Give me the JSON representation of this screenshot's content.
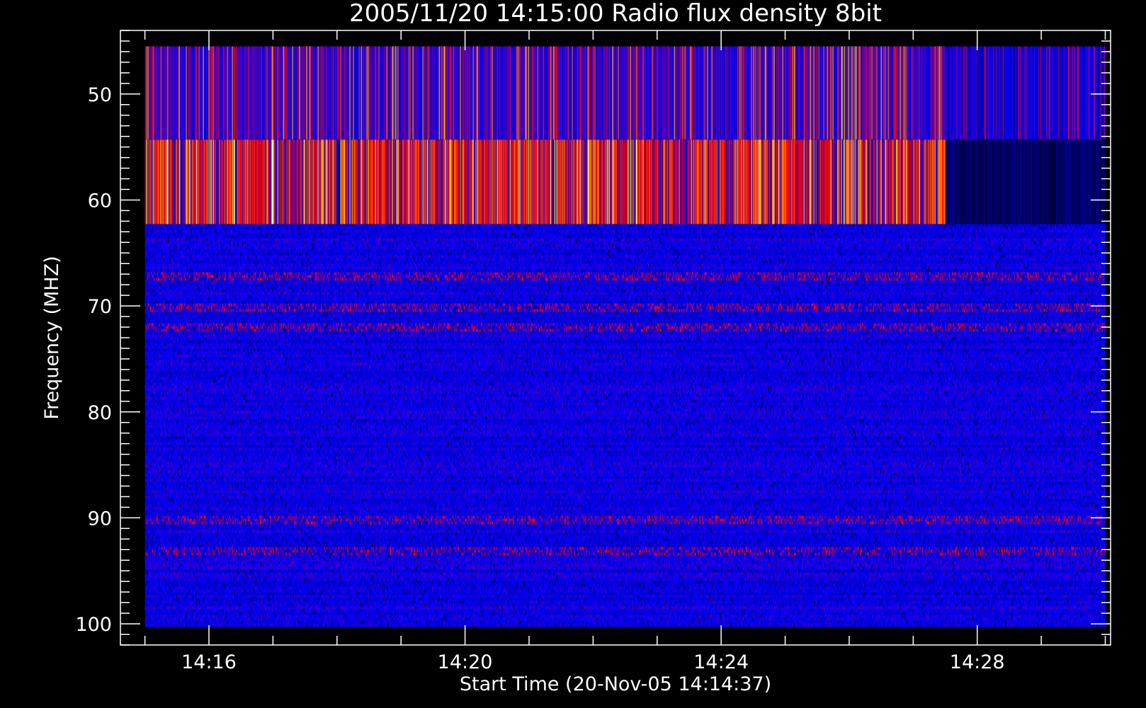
{
  "chart_data": {
    "type": "heatmap",
    "title": "2005/11/20 14:15:00 Radio flux density 8bit",
    "xlabel": "Start Time (20-Nov-05 14:14:37)",
    "ylabel": "Frequency (MHZ)",
    "x_start": "14:14:37",
    "x_major_ticks": [
      "14:16",
      "14:20",
      "14:24",
      "14:28"
    ],
    "x_range_minutes": [
      14.617,
      30.083
    ],
    "data_time_range": [
      "14:15:00",
      "14:30:00"
    ],
    "y_major_ticks": [
      50,
      60,
      70,
      80,
      90,
      100
    ],
    "ylim": [
      44,
      102
    ],
    "y_reversed": true,
    "data_freq_range_mhz": [
      45.5,
      100.3
    ],
    "colormap": [
      "#000000",
      "#0000ff",
      "#ff0000",
      "#ffff00",
      "#ffffff"
    ],
    "bands": [
      {
        "freq_mhz": [
          45.5,
          54.3
        ],
        "level": "moderate",
        "note": "mixed blue and red with sporadic red/yellow spikes"
      },
      {
        "freq_mhz": [
          54.3,
          62.3
        ],
        "level": "high",
        "note": "intense red/orange/yellow striations, decaying to dark after 14:27:30"
      },
      {
        "freq_mhz": [
          62.3,
          101.0
        ],
        "level": "low",
        "note": "predominantly blue with weak red streaks near 67, 70, 90 and 93 MHz"
      }
    ],
    "grid": false
  }
}
